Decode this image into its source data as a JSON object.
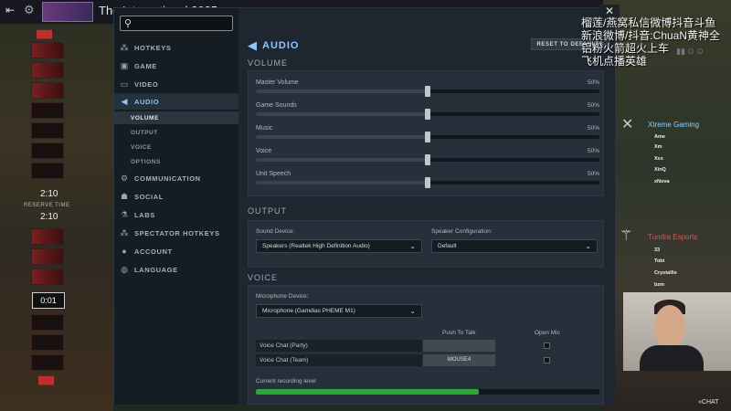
{
  "topbar": {
    "title": "The International 2025"
  },
  "game": {
    "timer_1": "2:10",
    "reserve_label": "RESERVE TIME",
    "timer_2": "2:10",
    "pick_timer": "0:01"
  },
  "settings": {
    "search": {
      "placeholder": ""
    },
    "nav": [
      {
        "label": "HOTKEYS",
        "icon": "hotkeys-icon"
      },
      {
        "label": "GAME",
        "icon": "game-icon"
      },
      {
        "label": "VIDEO",
        "icon": "video-icon"
      },
      {
        "label": "AUDIO",
        "icon": "speaker-icon",
        "active": true
      },
      {
        "label": "COMMUNICATION",
        "icon": "gear-icon"
      },
      {
        "label": "SOCIAL",
        "icon": "social-icon"
      },
      {
        "label": "LABS",
        "icon": "labs-icon"
      },
      {
        "label": "SPECTATOR HOTKEYS",
        "icon": "spectator-icon"
      },
      {
        "label": "ACCOUNT",
        "icon": "account-icon"
      },
      {
        "label": "LANGUAGE",
        "icon": "globe-icon"
      }
    ],
    "subnav": [
      {
        "label": "VOLUME",
        "active": true
      },
      {
        "label": "OUTPUT"
      },
      {
        "label": "VOICE"
      },
      {
        "label": "OPTIONS"
      }
    ],
    "header": {
      "title": "AUDIO",
      "reset_label": "RESET TO DEFAULTS"
    },
    "volume": {
      "section_title": "VOLUME",
      "sliders": [
        {
          "label": "Master Volume",
          "value": "50%",
          "level": 0.5
        },
        {
          "label": "Game Sounds",
          "value": "50%",
          "level": 0.5
        },
        {
          "label": "Music",
          "value": "50%",
          "level": 0.5
        },
        {
          "label": "Voice",
          "value": "50%",
          "level": 0.5
        },
        {
          "label": "Unit Speech",
          "value": "50%",
          "level": 0.5
        }
      ]
    },
    "output": {
      "section_title": "OUTPUT",
      "sound_device_label": "Sound Device:",
      "sound_device_value": "Speakers (Realtek High Definition Audio)",
      "speaker_config_label": "Speaker Configuration:",
      "speaker_config_value": "Default"
    },
    "voice": {
      "section_title": "VOICE",
      "mic_label": "Microphone Device:",
      "mic_value": "Microphone (Gamdias PHEME M1)",
      "ptt_header": "Push To Talk",
      "open_mic_header": "Open Mic",
      "rows": [
        {
          "label": "Voice Chat (Party)",
          "key": ""
        },
        {
          "label": "Voice Chat (Team)",
          "key": "MOUSE4"
        }
      ],
      "recording_label": "Current recording level",
      "recording_level": 0.65
    }
  },
  "overlay": {
    "lines": [
      "榴莲/燕窝私信微博抖音斗鱼",
      "新浪微博/抖音:ChuaN黄神全",
      "铝粉火箭超火上车",
      "飞机点播英雄"
    ],
    "team1": {
      "name": "Xtreme Gaming",
      "members": [
        "Ame",
        "Xm",
        "Xxs",
        "XinQ",
        "xNova"
      ]
    },
    "team2": {
      "name": "Tundra Esports",
      "members": [
        "33",
        "Tobi",
        "Crystallis",
        "bzm"
      ]
    },
    "chat_label": "CHAT"
  },
  "colors": {
    "accent": "#8fc4ff",
    "recording": "#2fa53a"
  }
}
